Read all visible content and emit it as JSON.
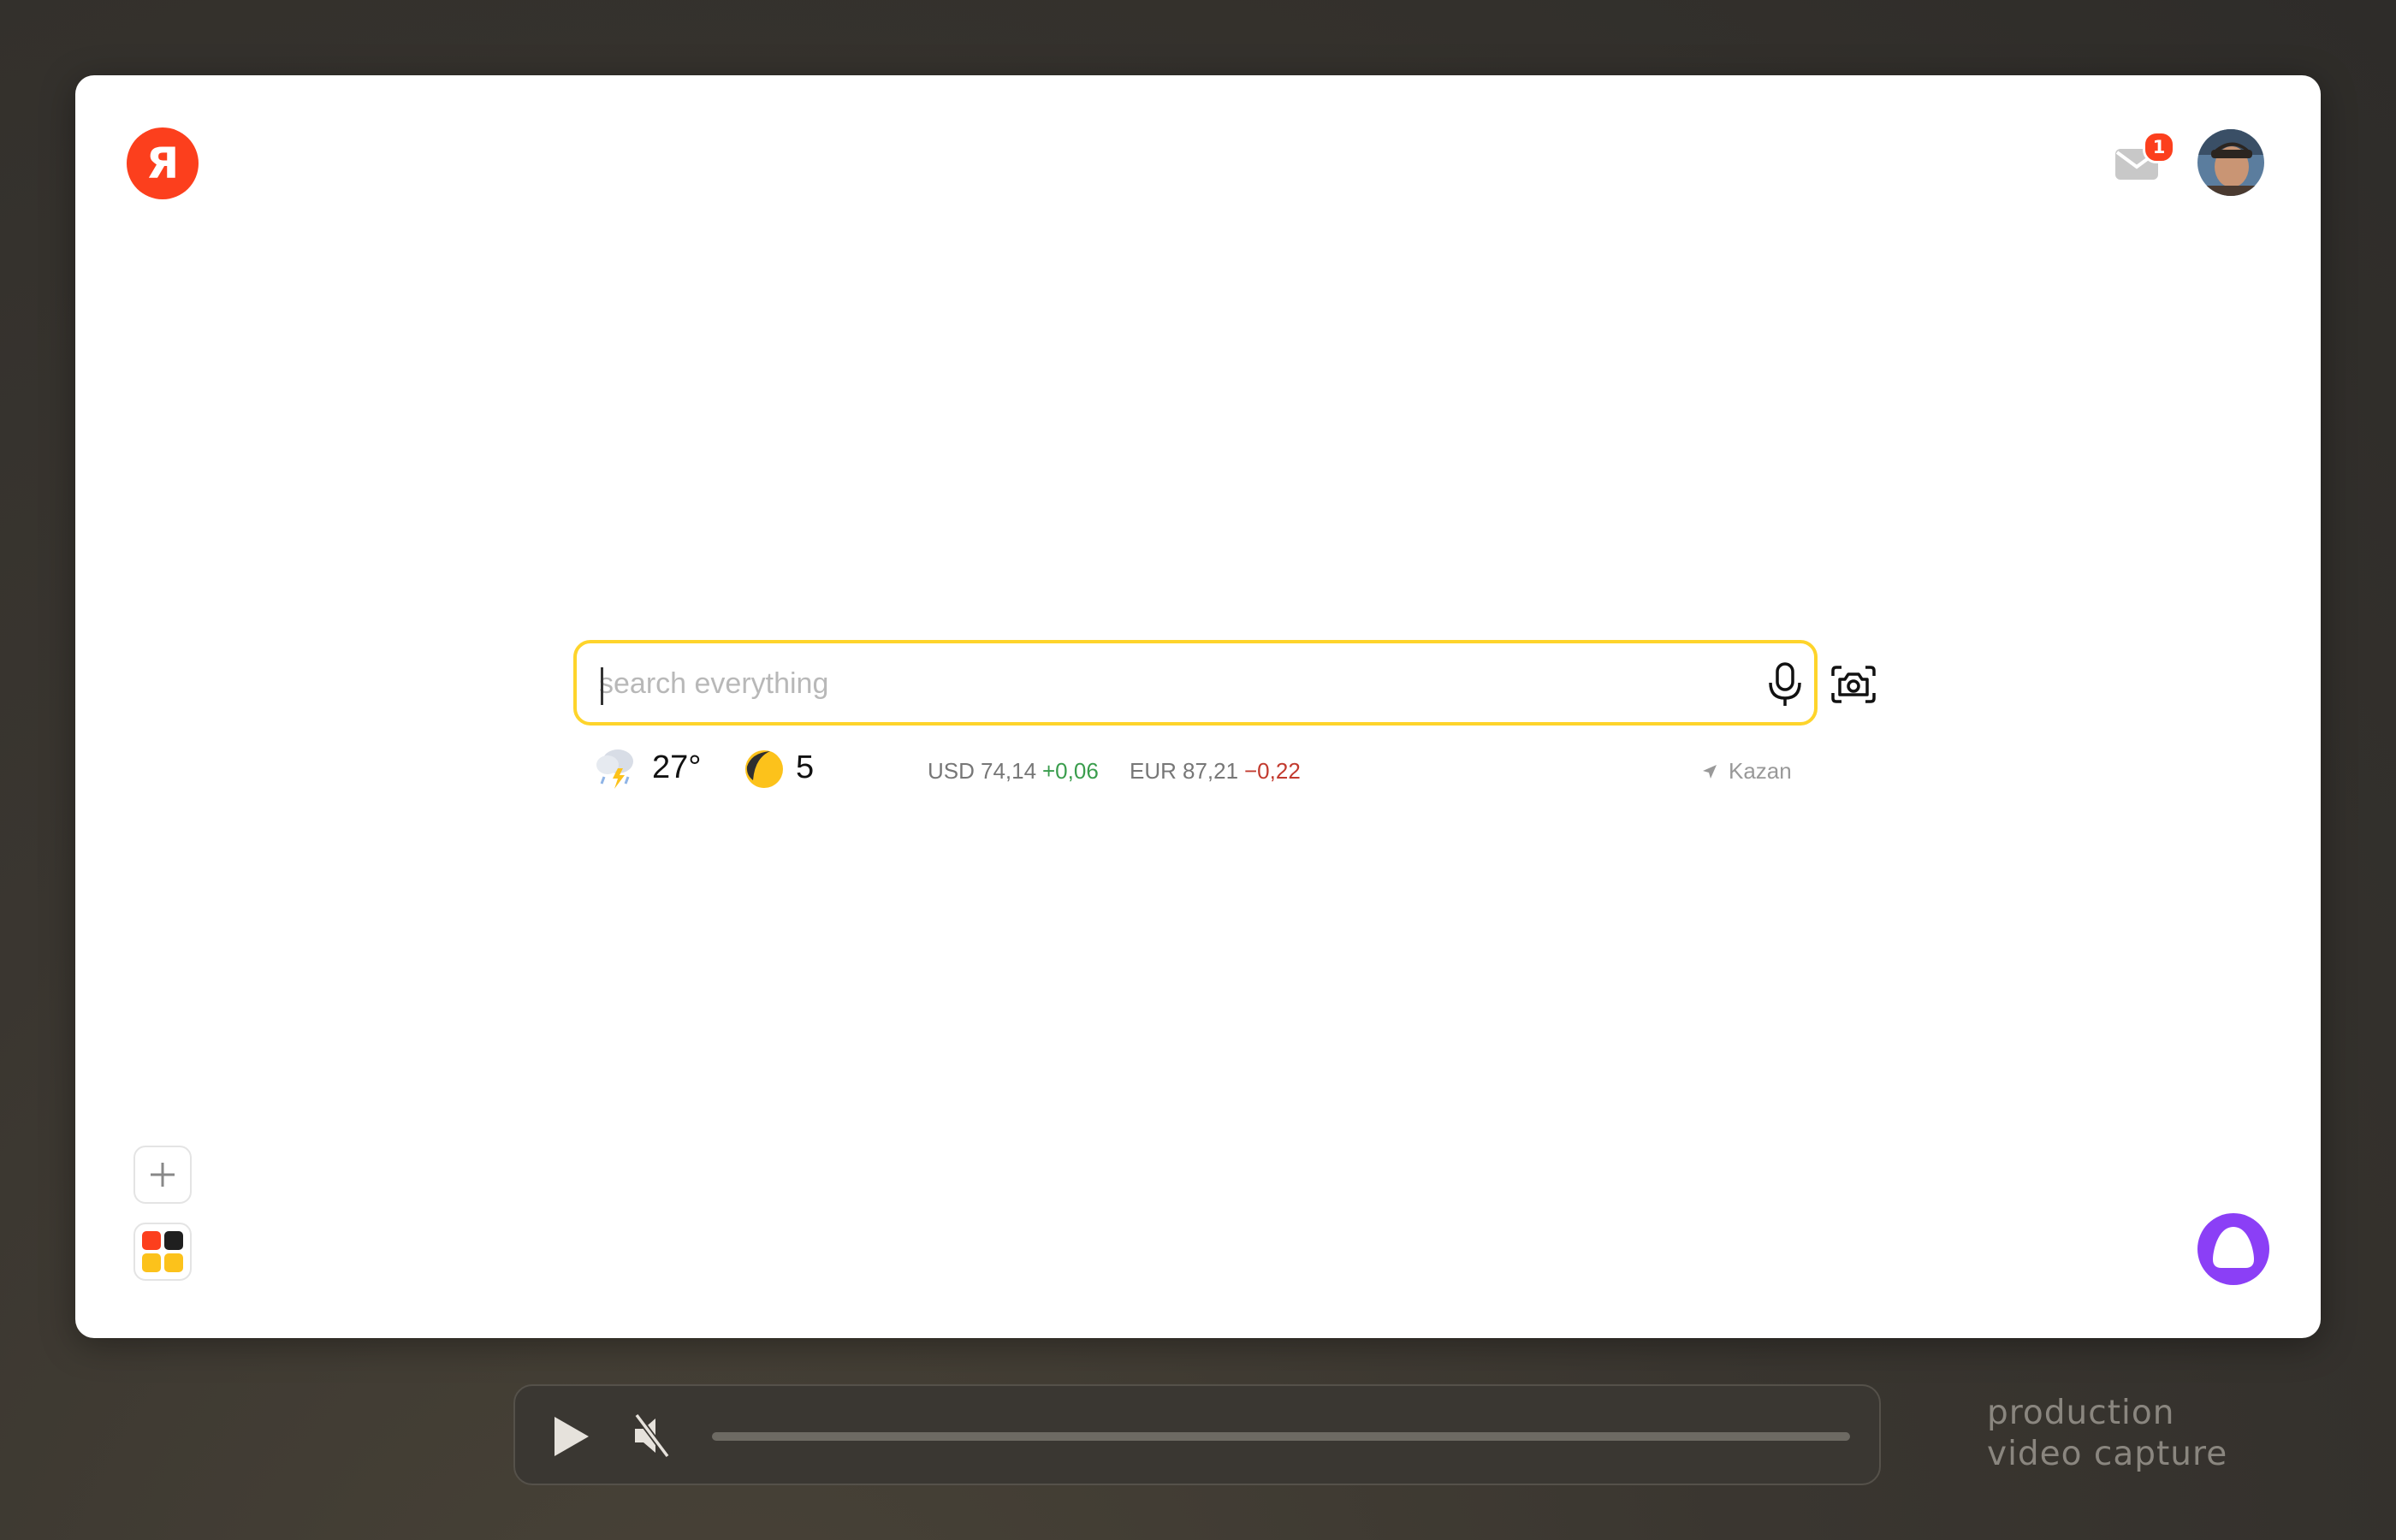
{
  "header": {
    "logo_letter": "Я",
    "mail_badge_count": "1",
    "avatar_icon": "user-avatar"
  },
  "search": {
    "placeholder": "search everything",
    "value": "",
    "voice_icon": "microphone-icon",
    "camera_icon": "camera-icon"
  },
  "info": {
    "weather_icon": "thunderstorm-icon",
    "temperature": "27°",
    "traffic_icon": "traffic-icon",
    "traffic_score": "5",
    "usd_label": "USD",
    "usd_value": "74,14",
    "usd_change": "+0,06",
    "eur_label": "EUR",
    "eur_value": "87,21",
    "eur_change": "−0,22",
    "location": "Kazan"
  },
  "sidebar": {
    "add_icon": "plus-icon",
    "apps_icon": "apps-grid-icon"
  },
  "assistant_icon": "alice-icon",
  "player": {
    "play_icon": "play-icon",
    "mute_icon": "muted-speaker-icon",
    "progress": 0.0
  },
  "caption": {
    "line1": "production",
    "line2": "video capture"
  },
  "colors": {
    "brand_red": "#fc3f1d",
    "search_border": "#fed42b",
    "alice_purple": "#8b3ff6",
    "positive": "#3a9d4d",
    "negative": "#c23a2e"
  }
}
